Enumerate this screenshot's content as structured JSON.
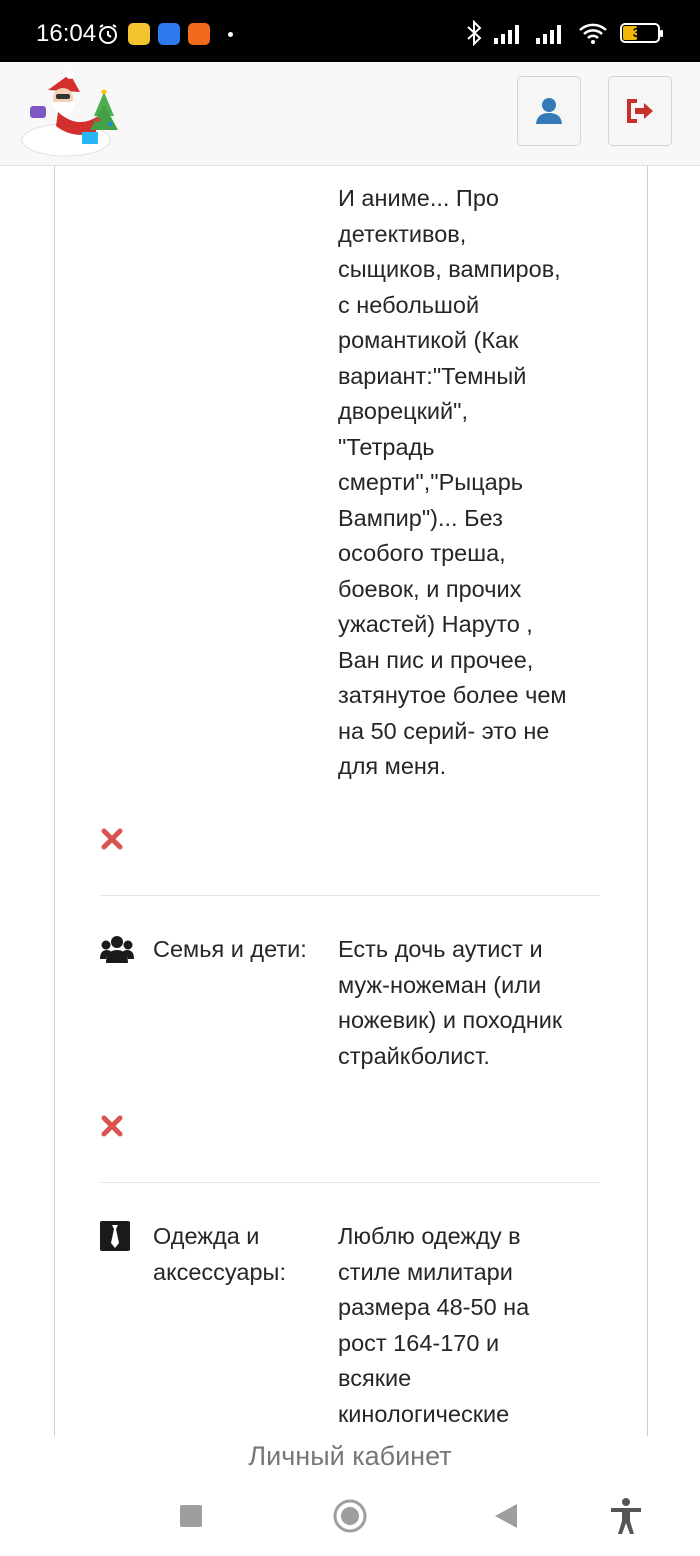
{
  "status_bar": {
    "time": "16:04",
    "battery": "39",
    "icons": [
      "alarm-icon",
      "app-icon",
      "app-icon",
      "app-icon",
      "bluetooth-icon",
      "signal-icon",
      "signal-icon",
      "wifi-icon",
      "battery-icon"
    ]
  },
  "header": {
    "logo": "santa-logo",
    "buttons": [
      "user-icon",
      "logout-icon"
    ]
  },
  "sections": [
    {
      "icon": "",
      "label": "",
      "value": "И аниме... Про детективов, сыщиков, вампиров, с небольшой романтикой (Как вариант:\"Темный дворецкий\", \"Тетрадь смерти\",\"Рыцарь Вампир\")... Без особого треша, боевок, и прочих ужастей) Наруто , Ван пис и прочее, затянутое более чем на 50 серий- это не для меня."
    },
    {
      "icon": "users-icon",
      "label": "Семья и дети:",
      "value": "Есть дочь аутист и муж-ножеман (или ножевик) и походник страйкболист."
    },
    {
      "icon": "tie-icon",
      "label": "Одежда и аксессуары:",
      "value": "Люблю одежду в стиле милитари размера 48-50 на рост 164-170 и всякие кинологические"
    }
  ],
  "bottom_title": "Личный кабинет",
  "colors": {
    "remove": "#d9534f",
    "logout": "#c9302c",
    "user": "#337ab7"
  }
}
